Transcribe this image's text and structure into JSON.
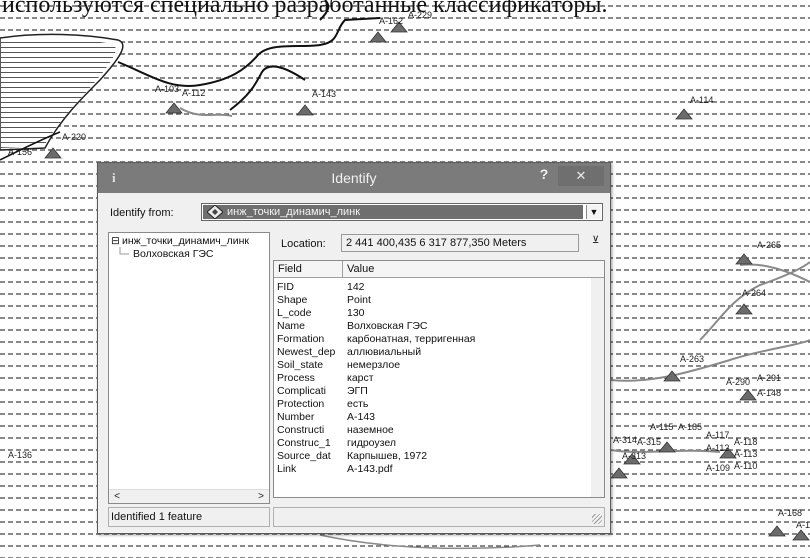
{
  "caption": "используются специально разработанные классификаторы.",
  "map": {
    "point_labels": [
      "А-229",
      "А-162",
      "А-103",
      "А-112",
      "А-143",
      "А-114",
      "А-220",
      "А-156",
      "А-265",
      "А-264",
      "А-263",
      "А-290",
      "А-291",
      "А-148",
      "А-115",
      "А-185",
      "А-314",
      "А-315",
      "А-313",
      "А-117",
      "А-118",
      "А-112",
      "А-113",
      "А-109",
      "А-110",
      "А-136",
      "А-168",
      "А-1"
    ],
    "colors": {
      "background": "#ffffff",
      "hatch": "#3a3a3a",
      "triangle": "#6b6b6b",
      "road": "#8a8a8a"
    }
  },
  "dialog": {
    "icon": "i",
    "title": "Identify",
    "help": "?",
    "close": "✕",
    "identify_from_label": "Identify from:",
    "identify_from_value": "инж_точки_динамич_линк",
    "tree": {
      "layer": "инж_точки_динамич_линк",
      "feature": "Волховская ГЭС",
      "expand_icon": "⊟"
    },
    "status": "Identified 1 feature",
    "location_label": "Location:",
    "location_value": "2 441 400,435  6 317 877,350 Meters",
    "table": {
      "headers": [
        "Field",
        "Value"
      ],
      "rows": [
        {
          "field": "FID",
          "value": "142"
        },
        {
          "field": "Shape",
          "value": "Point"
        },
        {
          "field": "L_code",
          "value": "130"
        },
        {
          "field": "Name",
          "value": "Волховская ГЭС"
        },
        {
          "field": "Formation",
          "value": "карбонатная, терригенная"
        },
        {
          "field": "Newest_dep",
          "value": "аллювиальный"
        },
        {
          "field": "Soil_state",
          "value": "немерзлое"
        },
        {
          "field": "Process",
          "value": "карст"
        },
        {
          "field": "Complicati",
          "value": "ЭГП"
        },
        {
          "field": "Protection",
          "value": "есть"
        },
        {
          "field": "Number",
          "value": "А-143"
        },
        {
          "field": "Constructi",
          "value": "наземное"
        },
        {
          "field": "Construc_1",
          "value": "гидроузел"
        },
        {
          "field": "Source_dat",
          "value": "Карпышев, 1972"
        },
        {
          "field": "Link",
          "value": "А-143.pdf"
        }
      ]
    },
    "colors": {
      "titlebar": "#7b7b7b",
      "selection": "#6e6e6e",
      "window": "#f0f0f0"
    }
  }
}
